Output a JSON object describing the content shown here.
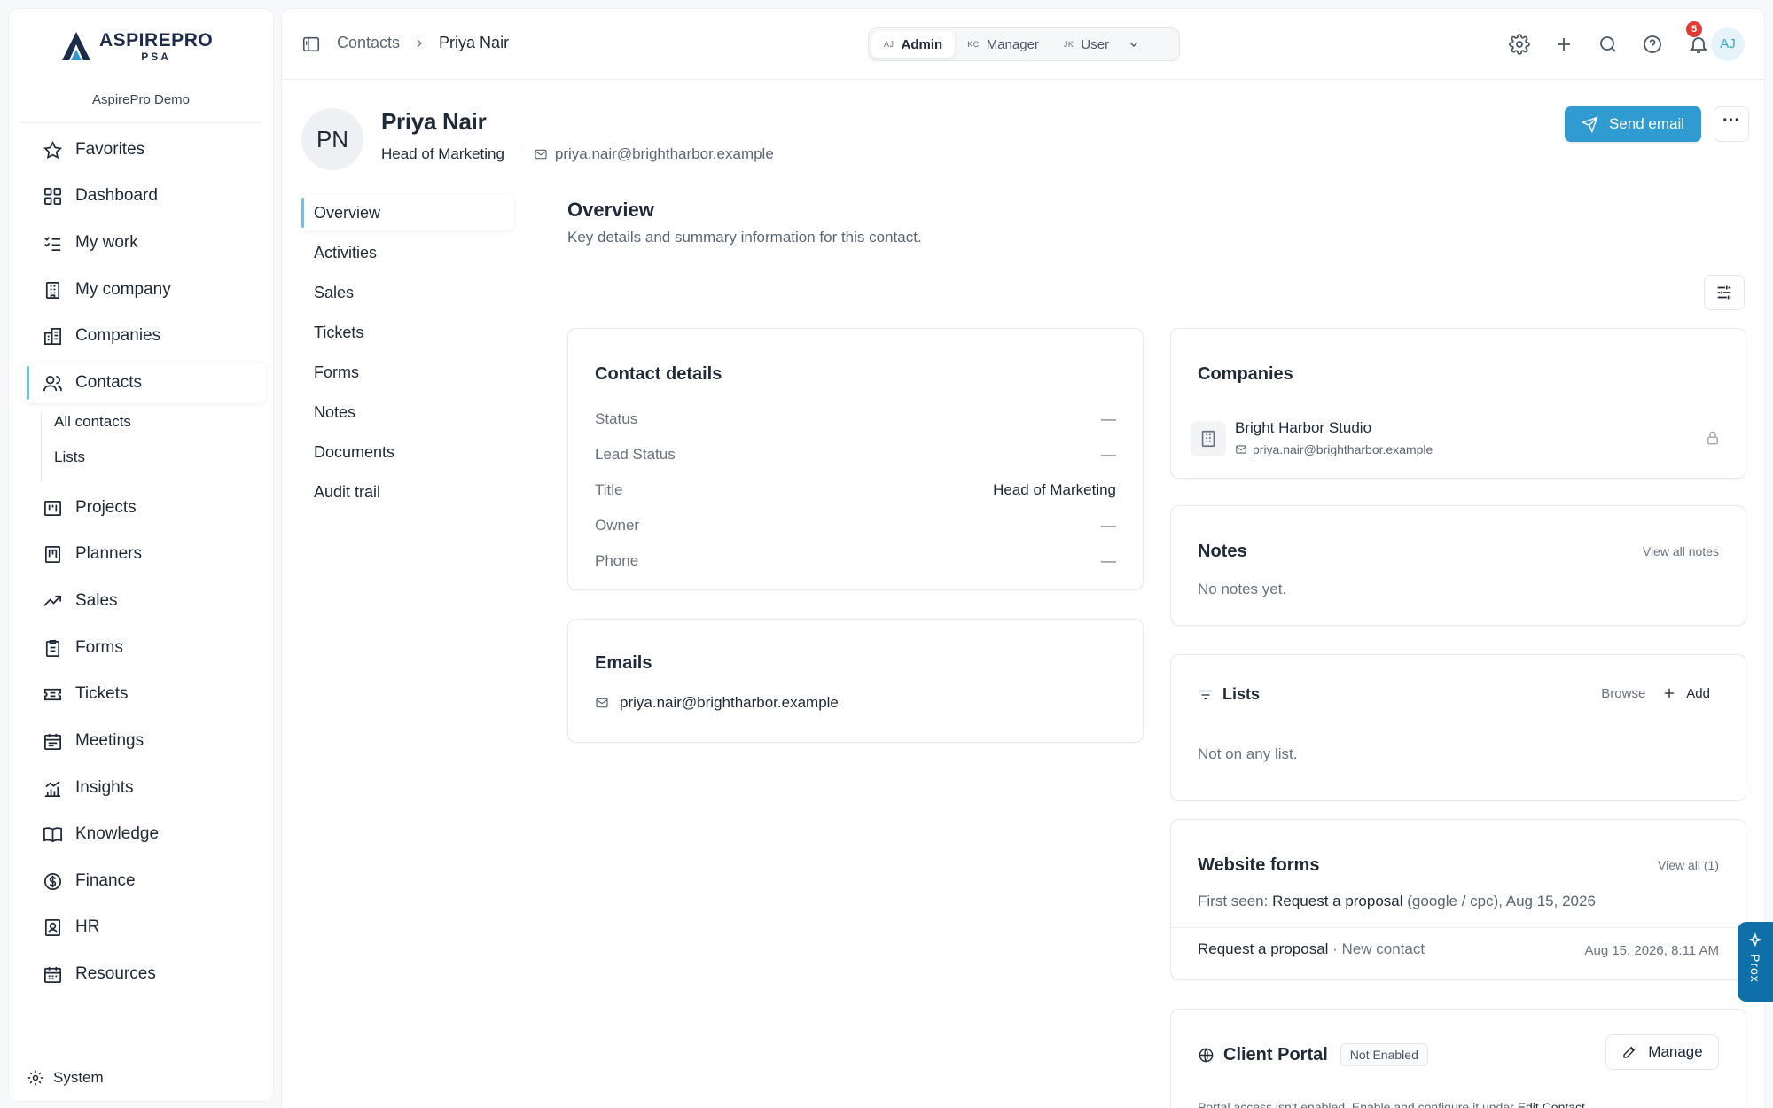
{
  "brand": {
    "name": "ASPIREPRO",
    "sub": "PSA",
    "org": "AspirePro Demo",
    "accent": "#2f9bd0"
  },
  "sidebar": {
    "items": [
      {
        "label": "Favorites",
        "icon": "star-icon"
      },
      {
        "label": "Dashboard",
        "icon": "grid-icon"
      },
      {
        "label": "My work",
        "icon": "checklist-icon"
      },
      {
        "label": "My company",
        "icon": "building-icon"
      },
      {
        "label": "Companies",
        "icon": "buildings-icon"
      },
      {
        "label": "Contacts",
        "icon": "users-icon",
        "active": true
      },
      {
        "label": "Projects",
        "icon": "kanban-icon"
      },
      {
        "label": "Planners",
        "icon": "planner-icon"
      },
      {
        "label": "Sales",
        "icon": "trend-icon"
      },
      {
        "label": "Forms",
        "icon": "clipboard-icon"
      },
      {
        "label": "Tickets",
        "icon": "ticket-icon"
      },
      {
        "label": "Meetings",
        "icon": "calendar-icon"
      },
      {
        "label": "Insights",
        "icon": "chart-icon"
      },
      {
        "label": "Knowledge",
        "icon": "book-icon"
      },
      {
        "label": "Finance",
        "icon": "dollar-icon"
      },
      {
        "label": "HR",
        "icon": "badge-icon"
      },
      {
        "label": "Resources",
        "icon": "calendar-grid-icon"
      }
    ],
    "contacts_sub": [
      "All contacts",
      "Lists"
    ],
    "system": "System"
  },
  "topbar": {
    "breadcrumb": [
      "Contacts",
      "Priya Nair"
    ],
    "roles": [
      {
        "initials": "AJ",
        "label": "Admin",
        "active": true
      },
      {
        "initials": "KC",
        "label": "Manager"
      },
      {
        "initials": "JK",
        "label": "User"
      }
    ],
    "notifications": "5",
    "user_initials": "AJ"
  },
  "contact": {
    "initials": "PN",
    "name": "Priya Nair",
    "title": "Head of Marketing",
    "email": "priya.nair@brightharbor.example",
    "send_email": "Send email",
    "more": "···"
  },
  "subnav": [
    "Overview",
    "Activities",
    "Sales",
    "Tickets",
    "Forms",
    "Notes",
    "Documents",
    "Audit trail"
  ],
  "overview": {
    "title": "Overview",
    "subtitle": "Key details and summary information for this contact."
  },
  "details": {
    "title": "Contact details",
    "rows": [
      {
        "label": "Status",
        "value": "—"
      },
      {
        "label": "Lead Status",
        "value": "—"
      },
      {
        "label": "Title",
        "value": "Head of Marketing"
      },
      {
        "label": "Owner",
        "value": "—"
      },
      {
        "label": "Phone",
        "value": "—"
      }
    ]
  },
  "emails": {
    "title": "Emails",
    "address": "priya.nair@brightharbor.example"
  },
  "companies": {
    "title": "Companies",
    "name": "Bright Harbor Studio",
    "email": "priya.nair@brightharbor.example"
  },
  "notes": {
    "title": "Notes",
    "link": "View all notes",
    "empty": "No notes yet."
  },
  "lists": {
    "title": "Lists",
    "browse": "Browse",
    "add": "Add",
    "empty": "Not on any list."
  },
  "website_forms": {
    "title": "Website forms",
    "link": "View all (1)",
    "first_seen_label": "First seen: ",
    "first_seen_form": "Request a proposal",
    "first_seen_detail": " (google / cpc), Aug 15, 2026",
    "row_form": "Request a proposal",
    "row_detail": " · New contact",
    "row_time": "Aug 15, 2026, 8:11 AM"
  },
  "client_portal": {
    "title": "Client Portal",
    "badge": "Not Enabled",
    "manage": "Manage",
    "text": "Portal access isn't enabled. Enable and configure it under ",
    "text_link": "Edit Contact",
    "text_end": "."
  },
  "prox": {
    "label": "Prox"
  }
}
